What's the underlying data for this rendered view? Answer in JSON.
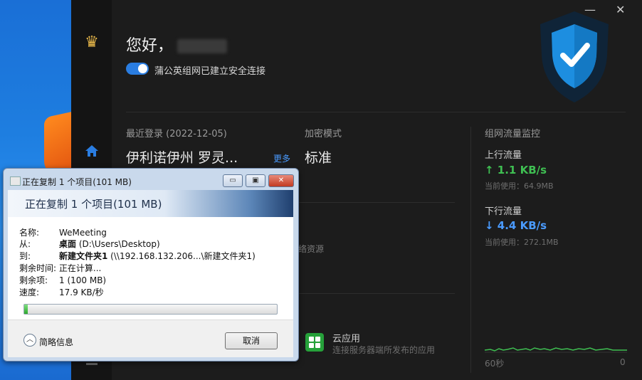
{
  "window": {
    "minimize_glyph": "—",
    "close_glyph": "✕"
  },
  "greeting": {
    "text": "您好，"
  },
  "connection": {
    "toggle_on": true,
    "label": "蒲公英组网已建立安全连接"
  },
  "recent_login": {
    "label": "最近登录",
    "date": "(2022-12-05)",
    "location": "伊利诺伊州 罗灵...",
    "more": "更多"
  },
  "encryption": {
    "label": "加密模式",
    "value": "标准"
  },
  "partial_text": "络资源",
  "network_monitor": {
    "title": "组网流量监控",
    "upload": {
      "label": "上行流量",
      "speed": "↑ 1.1 KB/s",
      "used": "当前使用：64.9MB"
    },
    "download": {
      "label": "下行流量",
      "speed": "↓ 4.4 KB/s",
      "used": "当前使用：272.1MB"
    },
    "axis_left": "60秒",
    "axis_right": "0"
  },
  "cloud_app": {
    "title": "云应用",
    "subtitle": "连接服务器端所发布的应用"
  },
  "copy_dialog": {
    "title": "正在复制 1 个项目(101 MB)",
    "header": "正在复制 1 个项目(101 MB)",
    "minimize": "▭",
    "maximize": "▣",
    "close": "✕",
    "fields": {
      "name_k": "名称:",
      "name_v": "WeMeeting",
      "from_k": "从:",
      "from_bold": "桌面",
      "from_rest": " (D:\\Users\\Desktop)",
      "to_k": "到:",
      "to_bold": "新建文件夹1",
      "to_rest": " (\\\\192.168.132.206...\\新建文件夹1)",
      "time_k": "剩余时间:",
      "time_v": "正在计算...",
      "items_k": "剩余项:",
      "items_v": "1 (100 MB)",
      "speed_k": "速度:",
      "speed_v": "17.9 KB/秒"
    },
    "progress": 0.01,
    "details": "简略信息",
    "cancel": "取消"
  },
  "colors": {
    "accent": "#2a7de1",
    "upload": "#3fbf52",
    "download": "#4a9bff"
  }
}
